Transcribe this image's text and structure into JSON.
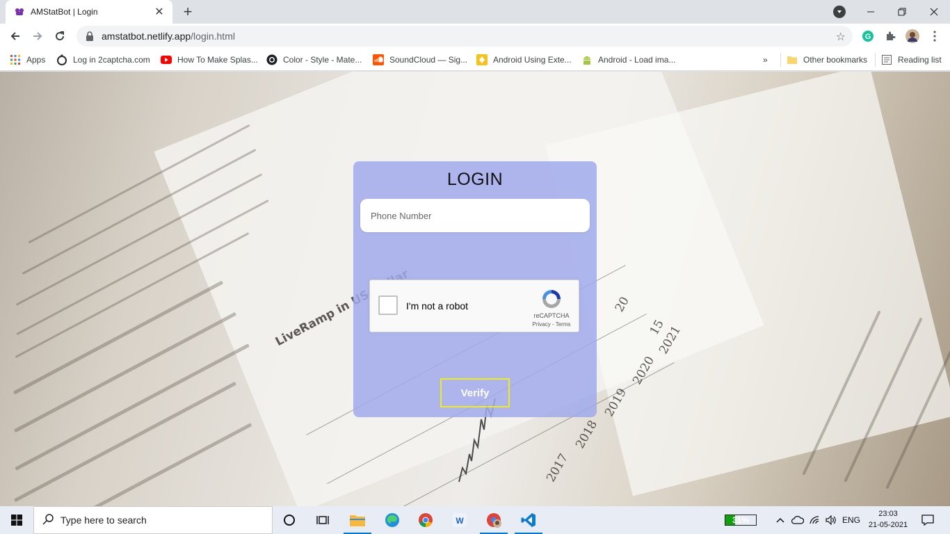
{
  "browser": {
    "tab": {
      "title": "AMStatBot | Login"
    },
    "url": {
      "host": "amstatbot.netlify.app",
      "path": "/login.html"
    }
  },
  "bookmarks": [
    {
      "label": "Apps",
      "icon": "apps-grid-icon"
    },
    {
      "label": "Log in 2captcha.com",
      "icon": "2captcha-icon"
    },
    {
      "label": "How To Make Splas...",
      "icon": "youtube-icon"
    },
    {
      "label": "Color - Style - Mate...",
      "icon": "github-icon"
    },
    {
      "label": "SoundCloud — Sig...",
      "icon": "soundcloud-icon"
    },
    {
      "label": "Android Using Exte...",
      "icon": "bookmark-yellow-icon"
    },
    {
      "label": "Android - Load ima...",
      "icon": "android-icon"
    }
  ],
  "bookmarks_overflow": "»",
  "other_bookmarks": "Other bookmarks",
  "reading_list": "Reading list",
  "login": {
    "title": "LOGIN",
    "phone_placeholder": "Phone Number",
    "recaptcha_label": "I'm not a robot",
    "recaptcha_brand": "reCAPTCHA",
    "recaptcha_terms": "Privacy - Terms",
    "verify_label": "Verify"
  },
  "background": {
    "text": [
      "LiveRamp in US-Dollar",
      "2017",
      "2018",
      "2019",
      "2020",
      "2021",
      "20",
      "15"
    ]
  },
  "taskbar": {
    "search_placeholder": "Type here to search",
    "battery": "31%",
    "battery_level": 0.31,
    "language": "ENG",
    "time": "23:03",
    "date": "21-05-2021"
  },
  "colors": {
    "card": "#a0aaeb",
    "verify_border": "#ecec1e",
    "battery": "#10a010"
  }
}
